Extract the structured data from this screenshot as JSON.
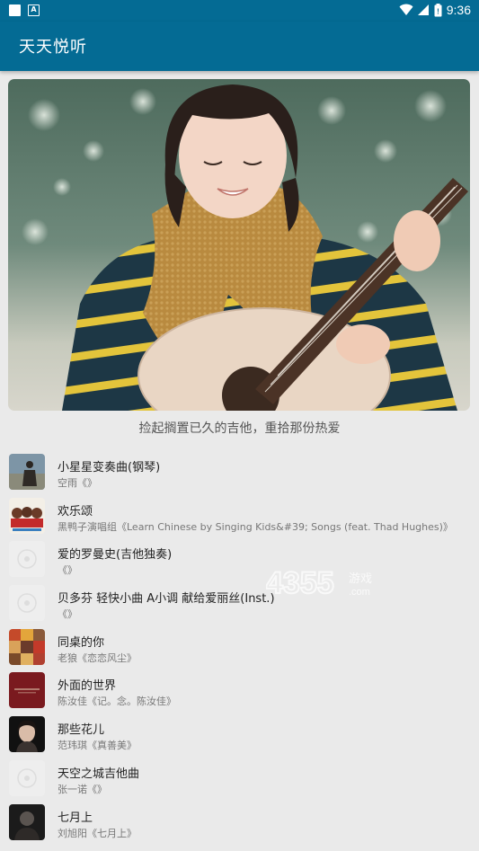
{
  "status_bar": {
    "time": "9:36",
    "left_icons": [
      "square-icon",
      "a-box-icon"
    ],
    "right_icons": [
      "wifi-icon",
      "signal-icon",
      "battery-icon"
    ]
  },
  "app_bar": {
    "title": "天天悦听",
    "color": "#046b94"
  },
  "banner": {
    "image": "girl-with-guitar-photo",
    "caption": "捡起搁置已久的吉他，重拾那份热爱"
  },
  "songs": [
    {
      "title": "小星星变奏曲(钢琴)",
      "subtitle": "空雨《》",
      "thumb": "photo"
    },
    {
      "title": "欢乐颂",
      "subtitle": "黑鸭子演唱组《Learn Chinese by Singing Kids&#39; Songs (feat. Thad Hughes)》",
      "thumb": "photo"
    },
    {
      "title": "爱的罗曼史(吉他独奏)",
      "subtitle": "《》",
      "thumb": "placeholder"
    },
    {
      "title": "贝多芬 轻快小曲 A小调 献给爱丽丝(Inst.)",
      "subtitle": "《》",
      "thumb": "placeholder"
    },
    {
      "title": "同桌的你",
      "subtitle": "老狼《恋恋风尘》",
      "thumb": "photo"
    },
    {
      "title": "外面的世界",
      "subtitle": "陈汝佳《记。念。陈汝佳》",
      "thumb": "photo"
    },
    {
      "title": "那些花儿",
      "subtitle": "范玮琪《真善美》",
      "thumb": "photo"
    },
    {
      "title": "天空之城吉他曲",
      "subtitle": "张一诺《》",
      "thumb": "placeholder"
    },
    {
      "title": "七月上",
      "subtitle": "刘旭阳《七月上》",
      "thumb": "photo"
    }
  ],
  "watermark": {
    "text": "4355",
    "suffix": "游戏",
    "domain": ".com"
  }
}
